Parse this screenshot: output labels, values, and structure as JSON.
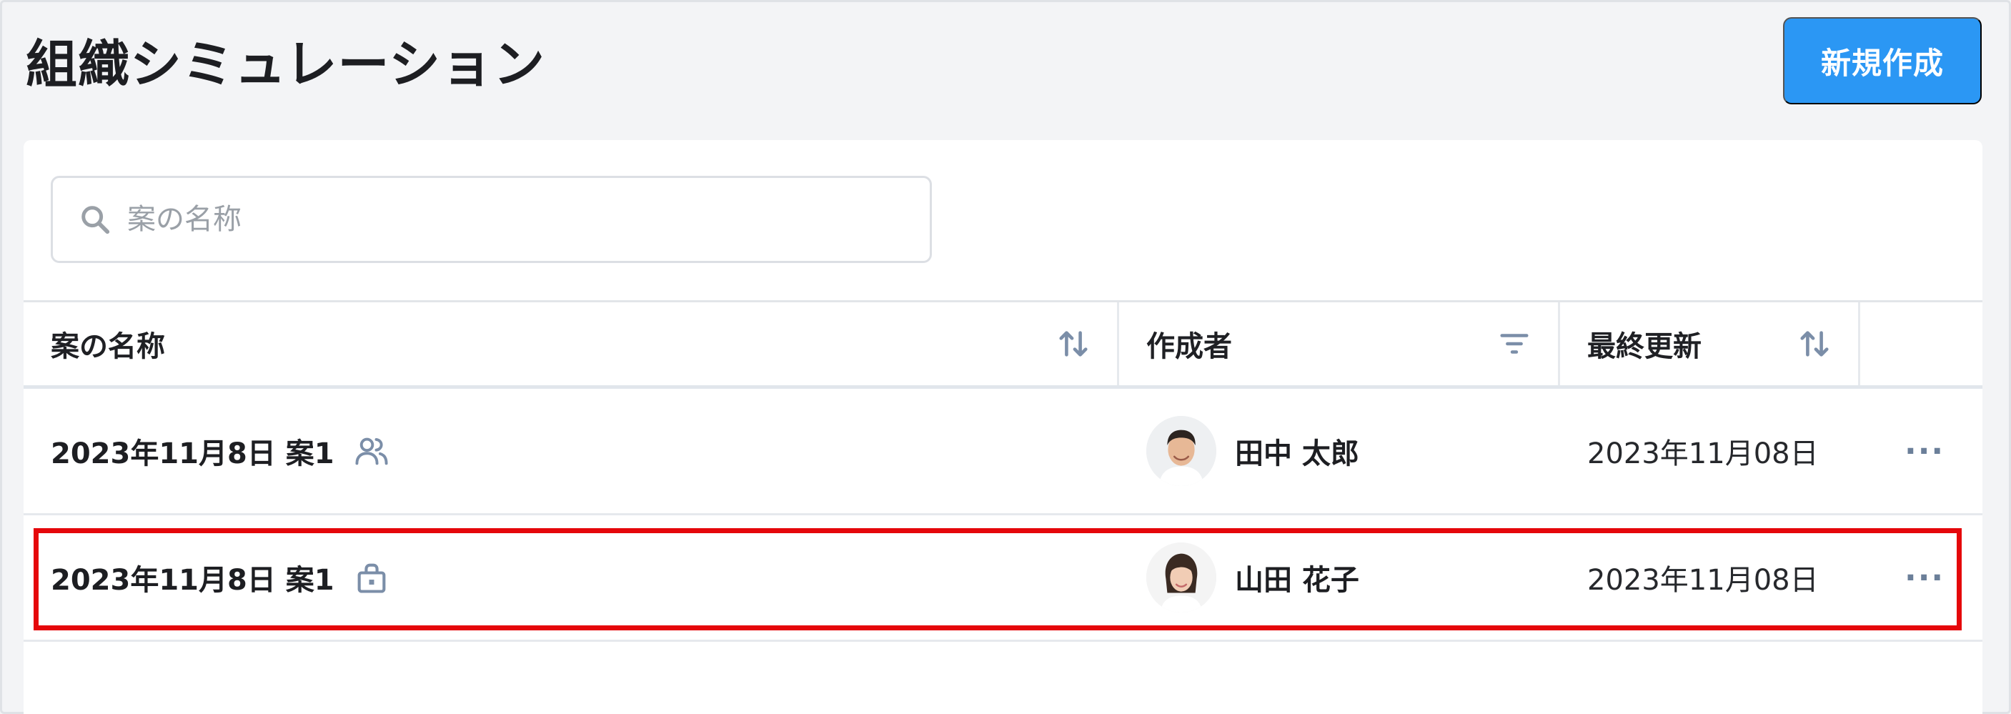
{
  "header": {
    "title": "組織シミュレーション",
    "new_button_label": "新規作成"
  },
  "search": {
    "placeholder": "案の名称",
    "value": ""
  },
  "table": {
    "columns": [
      {
        "label": "案の名称",
        "control": "sort-icon"
      },
      {
        "label": "作成者",
        "control": "filter-icon"
      },
      {
        "label": "最終更新",
        "control": "sort-icon"
      },
      {
        "label": ""
      }
    ],
    "rows": [
      {
        "title": "2023年11月8日 案1",
        "status_icon": "shared-users-icon",
        "author": "田中 太郎",
        "updated": "2023年11月08日",
        "menu": "···"
      },
      {
        "title": "2023年11月8日 案1",
        "status_icon": "private-lock-icon",
        "author": "山田 花子",
        "updated": "2023年11月08日",
        "menu": "···"
      }
    ]
  },
  "colors": {
    "accent": "#2b97f4",
    "highlight": "#e5070b",
    "icon": "#7b8ea8"
  }
}
